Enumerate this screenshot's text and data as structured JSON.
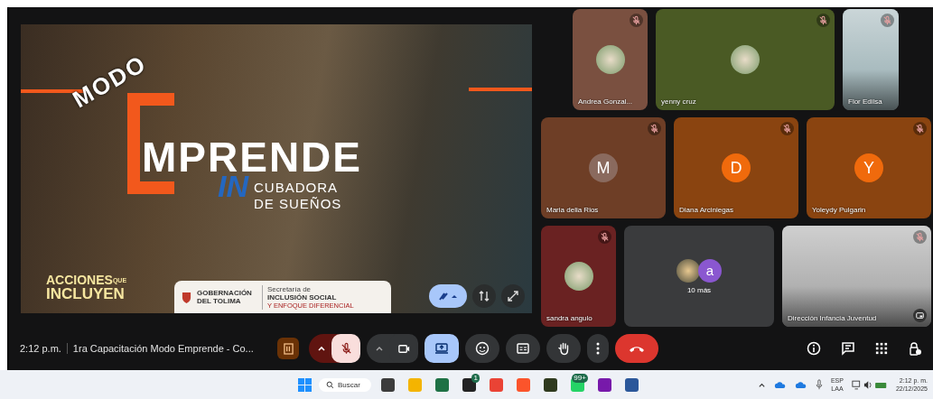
{
  "slide": {
    "script_word": "MODO",
    "title_rest": "MPRENDE",
    "mark": "IN",
    "subtitle": [
      "CUBADORA",
      "DE SUEÑOS"
    ],
    "brand": {
      "top": "ACCIONES",
      "small": "QUE",
      "bottom": "INCLUYEN"
    },
    "sponsor": {
      "left": "GOBERNACIÓN DEL TOLIMA",
      "right_small": "Secretaría de",
      "right_big": "INCLUSIÓN SOCIAL",
      "right_sub": "Y ENFOQUE DIFERENCIAL"
    },
    "tools": [
      {
        "kind": "annotate",
        "selected": true
      },
      {
        "kind": "swap",
        "selected": false
      },
      {
        "kind": "fullscreen",
        "selected": false
      }
    ]
  },
  "participants": [
    [
      {
        "name": "Andrea Gonzal...",
        "kind": "picture",
        "muted": true,
        "color": "#7a5040"
      },
      {
        "name": "yenny cruz",
        "kind": "picture",
        "muted": true,
        "color": "#4a5a24"
      },
      {
        "name": "Flor Edilsa",
        "kind": "video",
        "muted": true,
        "color": "#9fb4b8"
      }
    ],
    [
      {
        "name": "Maria delia Rios",
        "kind": "initial",
        "avatar": {
          "initial": "M",
          "color": "#8a6a5e"
        },
        "muted": true,
        "color": "#6e3e26"
      },
      {
        "name": "Diana Arciniegas",
        "kind": "initial",
        "avatar": {
          "initial": "D",
          "color": "#f06a0c"
        },
        "muted": true,
        "color": "#8a4410"
      },
      {
        "name": "Yoleydy Pulgarin",
        "kind": "initial",
        "avatar": {
          "initial": "Y",
          "color": "#f06a0c"
        },
        "muted": true,
        "color": "#8a4410"
      }
    ],
    [
      {
        "name": "sandra angulo",
        "kind": "picture",
        "muted": true,
        "color": "#6a2222"
      },
      {
        "name": "10 más",
        "kind": "others",
        "avatar": {
          "initial": "a",
          "color": "#8a57d0"
        },
        "muted": false,
        "color": "#3a3b3d"
      },
      {
        "name": "Dirección Infancia Juventud",
        "kind": "video",
        "muted": true,
        "color": "#a8a8a8"
      }
    ]
  ],
  "meeting": {
    "time": "2:12 p.m.",
    "title": "1ra Capacitación Modo Emprende - Co..."
  },
  "controls": [
    {
      "kind": "activities"
    },
    {
      "kind": "mic",
      "muted": true
    },
    {
      "kind": "camera",
      "muted": false
    },
    {
      "kind": "present",
      "selected": true
    },
    {
      "kind": "reactions",
      "selected": false
    },
    {
      "kind": "captions",
      "selected": false
    },
    {
      "kind": "hand",
      "selected": false
    },
    {
      "kind": "more"
    },
    {
      "kind": "leave"
    }
  ],
  "side_controls": [
    {
      "kind": "info"
    },
    {
      "kind": "chat"
    },
    {
      "kind": "apps"
    },
    {
      "kind": "lock"
    }
  ],
  "taskbar": {
    "search": "Buscar",
    "apps": [
      {
        "color": "#3c3c3c"
      },
      {
        "color": "#f4b400"
      },
      {
        "color": "#1e7145"
      },
      {
        "color": "#222222",
        "badge": "1"
      },
      {
        "color": "#ea4335"
      },
      {
        "color": "#fb542b"
      },
      {
        "color": "#2f3a1e"
      },
      {
        "color": "#25d366",
        "badge": "99+"
      },
      {
        "color": "#7719aa"
      },
      {
        "color": "#2b579a"
      }
    ],
    "language": [
      "ESP",
      "LAA"
    ],
    "time": "2:12 p. m.",
    "date": "22/12/2025"
  }
}
